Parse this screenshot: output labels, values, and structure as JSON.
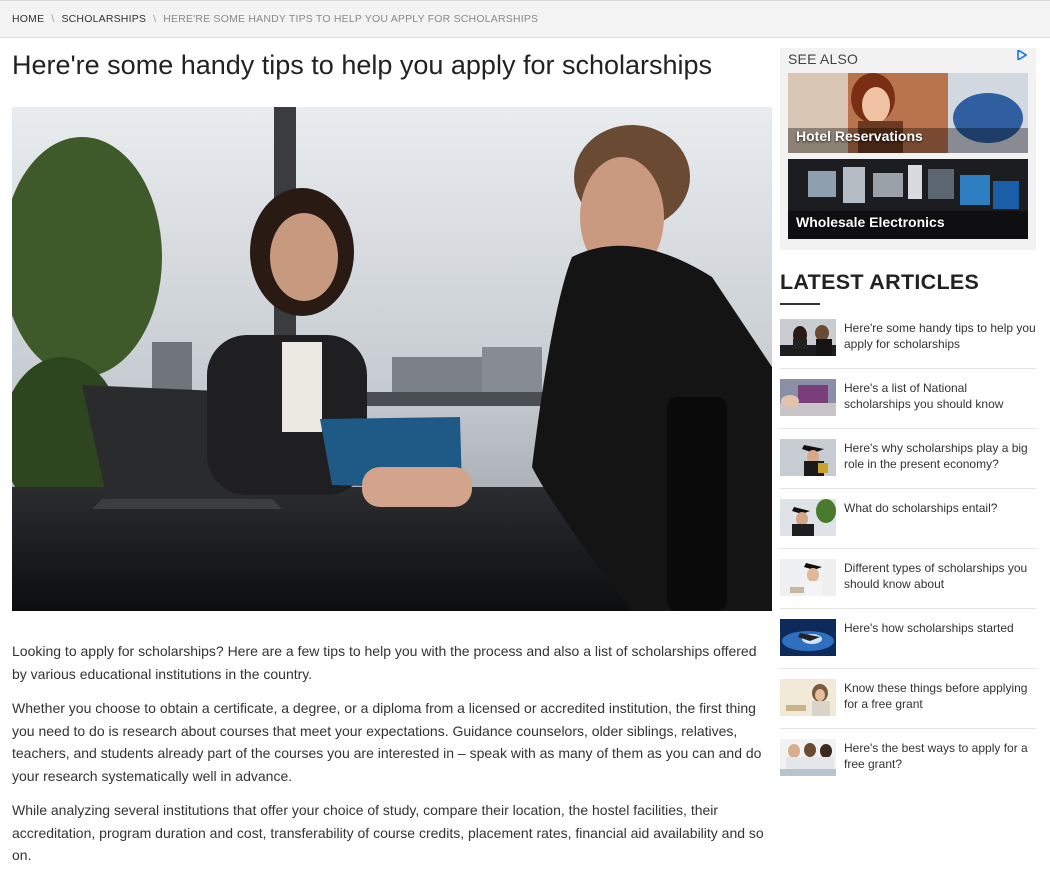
{
  "breadcrumb": {
    "items": [
      "HOME",
      "SCHOLARSHIPS",
      "HERE'RE SOME HANDY TIPS TO HELP YOU APPLY FOR SCHOLARSHIPS"
    ],
    "separator": "\\"
  },
  "article": {
    "title": "Here're some handy tips to help you apply for scholarships",
    "paragraphs": [
      "Looking to apply for scholarships? Here are a few tips to help you with the process and also a list of scholarships offered by various educational institutions in the country.",
      "Whether you choose to obtain a certificate, a degree, or a diploma from a licensed or accredited institution, the first thing you need to do is research about courses that meet your expectations. Guidance counselors, older siblings, relatives, teachers, and students already part of the courses you are interested in – speak with as many of them as you can and do your research systematically well in advance.",
      "While analyzing several institutions that offer your choice of study, compare their location, the hostel facilities, their accreditation, program duration and cost, transferability of course credits, placement rates, financial aid availability and so on."
    ]
  },
  "see_also": {
    "heading": "SEE ALSO",
    "ad_icon": "adchoices-icon",
    "tiles": [
      {
        "label": "Hotel Reservations"
      },
      {
        "label": "Wholesale Electronics"
      }
    ]
  },
  "latest": {
    "heading": "LATEST ARTICLES",
    "items": [
      {
        "title": "Here're some handy tips to help you apply for scholarships"
      },
      {
        "title": "Here's a list of National scholarships you should know"
      },
      {
        "title": "Here's why scholarships play a big role in the present economy?"
      },
      {
        "title": "What do scholarships entail?"
      },
      {
        "title": "Different types of scholarships you should know about"
      },
      {
        "title": "Here's how scholarships started"
      },
      {
        "title": "Know these things before applying for a free grant"
      },
      {
        "title": "Here's the best ways to apply for a free grant?"
      }
    ]
  }
}
